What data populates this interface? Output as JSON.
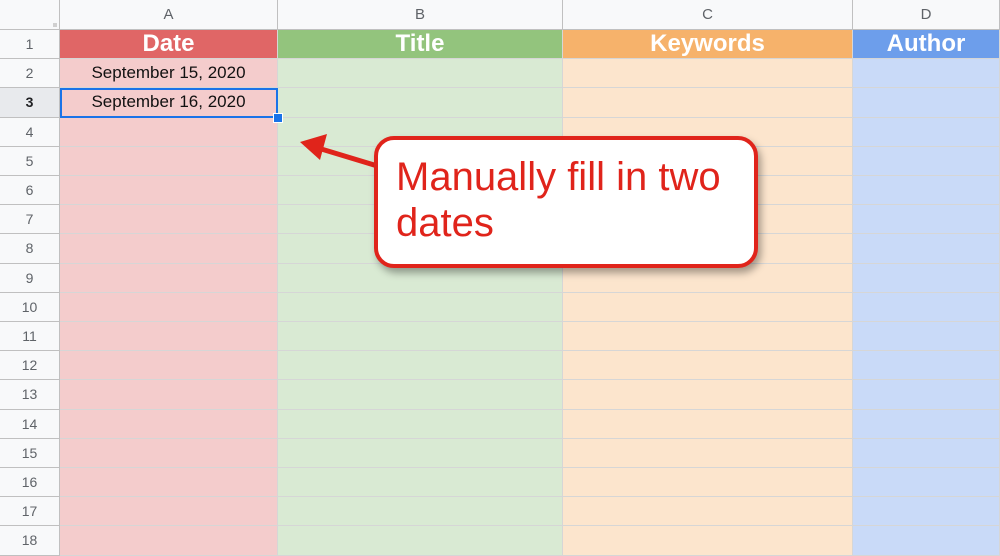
{
  "columns": [
    {
      "letter": "A",
      "header": "Date",
      "head_color": "#e06666",
      "body_color": "#f4cccc"
    },
    {
      "letter": "B",
      "header": "Title",
      "head_color": "#93c47d",
      "body_color": "#d9ead3"
    },
    {
      "letter": "C",
      "header": "Keywords",
      "head_color": "#f6b26b",
      "body_color": "#fce5cd"
    },
    {
      "letter": "D",
      "header": "Author",
      "head_color": "#6d9eeb",
      "body_color": "#c9daf8"
    }
  ],
  "rows": [
    "1",
    "2",
    "3",
    "4",
    "5",
    "6",
    "7",
    "8",
    "9",
    "10",
    "11",
    "12",
    "13",
    "14",
    "15",
    "16",
    "17",
    "18"
  ],
  "cells": {
    "A2": "September 15, 2020",
    "A3": "September 16, 2020"
  },
  "active_row": "3",
  "selected_cell": "A3",
  "selection_color": "#1a73e8",
  "callout": {
    "text": "Manually fill in two dates",
    "color": "#e0241b"
  }
}
